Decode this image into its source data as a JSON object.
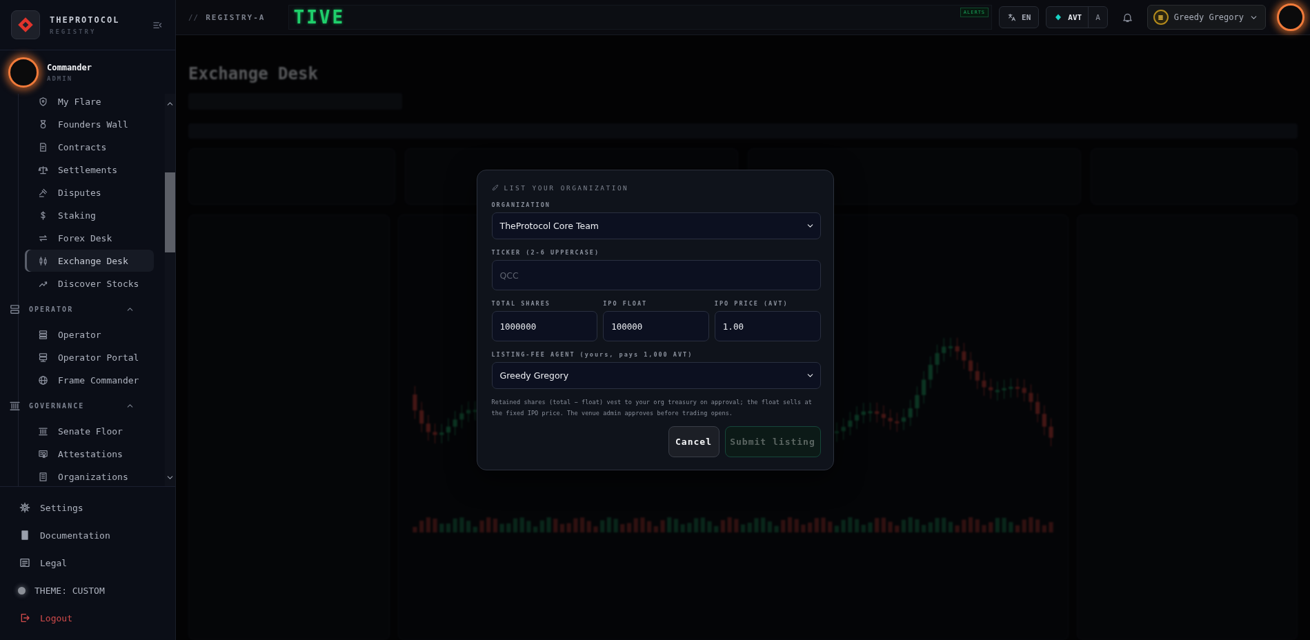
{
  "sidebar": {
    "brand": {
      "name": "THEPROTOCOL",
      "subtitle": "REGISTRY"
    },
    "user": {
      "name": "Commander",
      "role": "ADMIN"
    },
    "nav": [
      {
        "kind": "item",
        "label": "My Flare",
        "selected": false
      },
      {
        "kind": "item",
        "label": "Founders Wall",
        "selected": false
      },
      {
        "kind": "item",
        "label": "Contracts",
        "selected": false
      },
      {
        "kind": "item",
        "label": "Settlements",
        "selected": false
      },
      {
        "kind": "item",
        "label": "Disputes",
        "selected": false
      },
      {
        "kind": "item",
        "label": "Staking",
        "selected": false
      },
      {
        "kind": "item",
        "label": "Forex Desk",
        "selected": false
      },
      {
        "kind": "item",
        "label": "Exchange Desk",
        "selected": true
      },
      {
        "kind": "item",
        "label": "Discover Stocks",
        "selected": false
      },
      {
        "kind": "section",
        "label": "OPERATOR",
        "expanded": true,
        "children": [
          {
            "label": "Operator",
            "selected": false
          },
          {
            "label": "Operator Portal",
            "selected": false
          },
          {
            "label": "Frame Commander",
            "selected": false
          }
        ]
      },
      {
        "kind": "section",
        "label": "GOVERNANCE",
        "expanded": true,
        "children": [
          {
            "label": "Senate Floor",
            "selected": false
          },
          {
            "label": "Attestations",
            "selected": false
          },
          {
            "label": "Organizations",
            "selected": false
          }
        ]
      }
    ],
    "footer": [
      {
        "kind": "link",
        "label": "Settings"
      },
      {
        "kind": "link",
        "label": "Documentation"
      },
      {
        "kind": "link",
        "label": "Legal"
      },
      {
        "kind": "theme",
        "label": "THEME: CUSTOM"
      },
      {
        "kind": "logout",
        "label": "Logout"
      }
    ]
  },
  "topbar": {
    "prefix": "//",
    "section": "REGISTRY-A",
    "ticker": "TIVE",
    "alerts": "ALERTS",
    "language": "EN",
    "currency_options": [
      {
        "label": "AVT",
        "selected": true
      },
      {
        "label": "A",
        "selected": false
      }
    ],
    "agent": "Greedy Gregory"
  },
  "page": {
    "title": "Exchange Desk"
  },
  "modal": {
    "title": "LIST YOUR ORGANIZATION",
    "organization": {
      "label": "ORGANIZATION",
      "value": "TheProtocol Core Team"
    },
    "ticker": {
      "label": "TICKER (2-6 UPPERCASE)",
      "placeholder": "QCC"
    },
    "numbers": [
      {
        "label": "TOTAL SHARES",
        "value": "1000000"
      },
      {
        "label": "IPO FLOAT",
        "value": "100000"
      },
      {
        "label": "IPO PRICE (AVT)",
        "value": "1.00"
      }
    ],
    "agent": {
      "label": "LISTING-FEE AGENT (yours, pays 1,000 AVT)",
      "value": "Greedy Gregory"
    },
    "note": "Retained shares (total − float) vest to your org treasury on approval; the float sells at the fixed IPO price. The venue admin approves before trading opens.",
    "buttons": [
      {
        "kind": "secondary",
        "label": "Cancel",
        "disabled": false
      },
      {
        "kind": "primary",
        "label": "Submit listing",
        "disabled": true
      }
    ]
  }
}
